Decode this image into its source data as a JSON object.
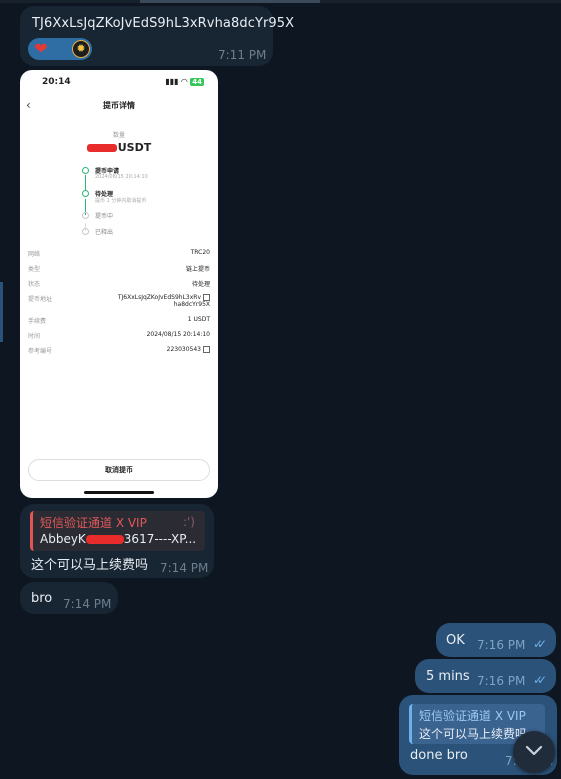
{
  "messages": {
    "m1": {
      "text": "TJ6XxLsJqZKoJvEdS9hL3xRvha8dcYr95X",
      "time": "7:11 PM",
      "reactions": [
        "red-heart",
        "user-avatar"
      ]
    },
    "m3": {
      "reply_title": "短信验证通道 X VIP",
      "reply_text_prefix": "AbbeyK",
      "reply_text_suffix": "3617----XP...",
      "reply_emoji": ":')",
      "text": "这个可以马上续费吗",
      "time": "7:14 PM"
    },
    "m4": {
      "text": "bro",
      "time": "7:14 PM"
    },
    "m5": {
      "text": "OK",
      "time": "7:16 PM",
      "status": "read"
    },
    "m6": {
      "text": "5 mins",
      "time": "7:16 PM",
      "status": "read"
    },
    "m7": {
      "reply_title": "短信验证通道 X VIP",
      "reply_text": "这个可以马上续费吗",
      "text": "done bro",
      "time": "7:25 PM"
    }
  },
  "screenshot": {
    "status_time": "20:14",
    "battery": "44",
    "page_title": "提币详情",
    "quantity_label": "数量",
    "amount_currency": "USDT",
    "steps": [
      {
        "label": "提币申请",
        "sub": "2024/08/15 20:14:10",
        "state": "done"
      },
      {
        "label": "待处理",
        "sub": "提币 1 分钟内取消提币",
        "state": "done"
      },
      {
        "label": "提币中",
        "sub": "",
        "state": "pending"
      },
      {
        "label": "已释出",
        "sub": "",
        "state": "pending"
      }
    ],
    "details": [
      {
        "key": "网络",
        "value": "TRC20"
      },
      {
        "key": "类型",
        "value": "链上提币"
      },
      {
        "key": "状态",
        "value": "待处理"
      },
      {
        "key": "提币地址",
        "value_line1": "TJ6XxLsJqZKoJvEdS9hL3xRv",
        "value_line2": "ha8dcYr95X"
      },
      {
        "key": "手续费",
        "value": "1 USDT"
      },
      {
        "key": "时间",
        "value": "2024/08/15 20:14:10"
      },
      {
        "key": "参考编号",
        "value": "223030543"
      }
    ],
    "cancel_button": "取消提币"
  }
}
